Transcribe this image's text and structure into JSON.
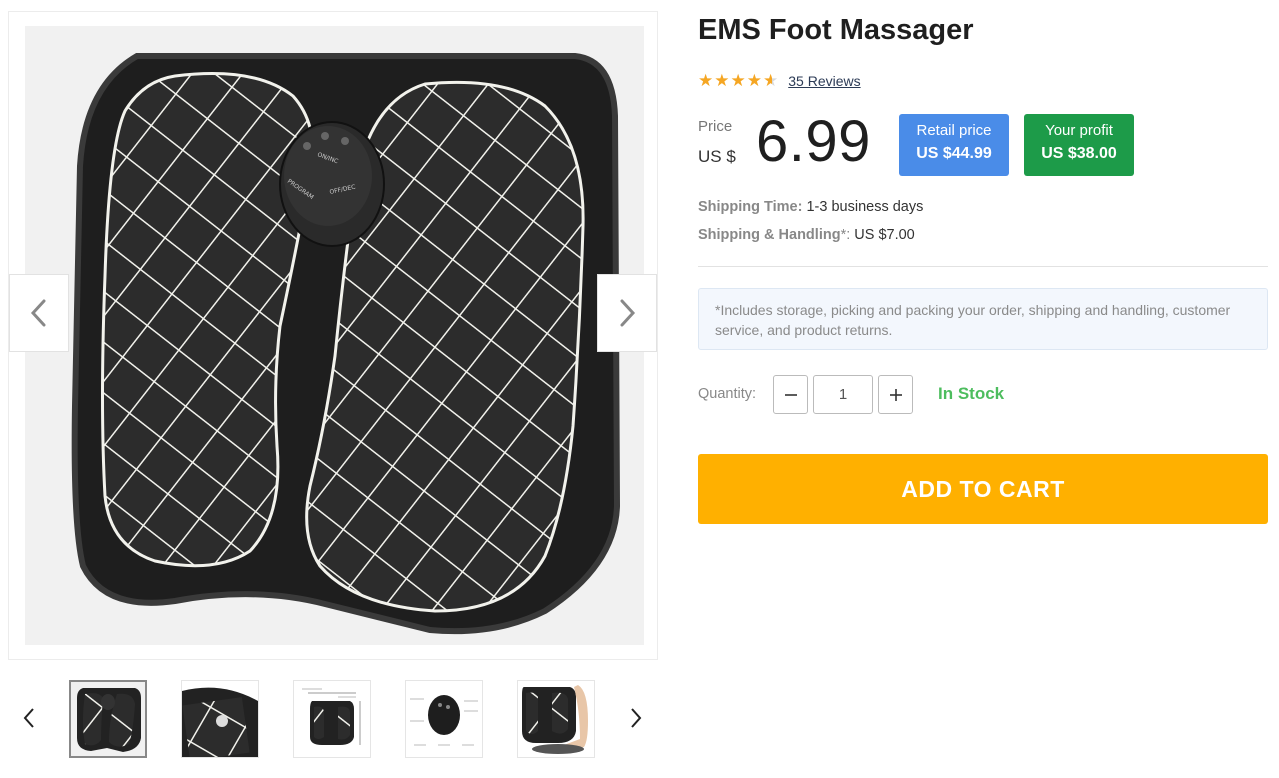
{
  "product": {
    "title": "EMS Foot Massager",
    "rating": 4.5,
    "reviews_label": "35 Reviews"
  },
  "pricing": {
    "price_label": "Price",
    "currency": "US $",
    "price": "6.99",
    "retail_label": "Retail price",
    "retail_value": "US $44.99",
    "profit_label": "Your profit",
    "profit_value": "US $38.00"
  },
  "shipping": {
    "time_label": "Shipping Time:",
    "time_value": "1-3 business days",
    "handling_label": "Shipping & Handling",
    "handling_asterisk": "*:",
    "handling_value": "US $7.00"
  },
  "note": "*Includes storage, picking and packing your order, shipping and handling, customer service, and product returns.",
  "quantity": {
    "label": "Quantity:",
    "value": "1",
    "stock_status": "In Stock"
  },
  "cta": {
    "add_to_cart": "ADD TO CART"
  },
  "image_labels": {
    "on_inc": "ON/INC",
    "off_dec": "OFF/DEC",
    "program": "PROGRAM"
  },
  "gallery": {
    "thumbnail_count": 5,
    "active_thumbnail": 1
  },
  "colors": {
    "star": "#f5a623",
    "retail_bg": "#4a8ce8",
    "profit_bg": "#1d9b49",
    "in_stock": "#4dbd5e",
    "cta_bg": "#ffb000"
  }
}
